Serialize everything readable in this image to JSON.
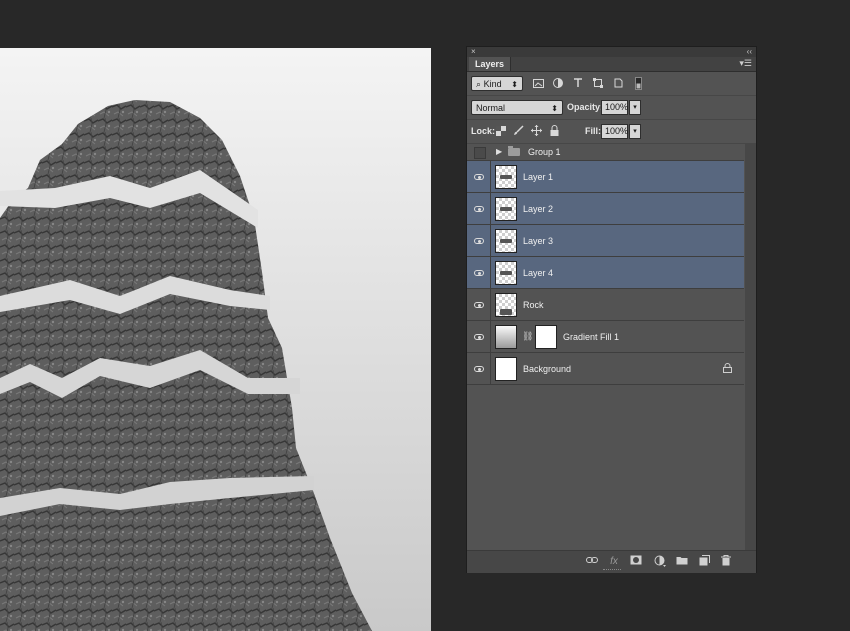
{
  "panel": {
    "close_glyph": "×",
    "collapse_glyph": "‹‹",
    "tab_label": "Layers",
    "menu_glyph": "▾☰"
  },
  "filter": {
    "kind_label": "Kind",
    "search_glyph": "⌕",
    "arrow_glyph": "⬍"
  },
  "blend": {
    "mode": "Normal",
    "arrow_glyph": "⬍",
    "opacity_label": "Opacity:",
    "opacity_value": "100%"
  },
  "lock": {
    "label": "Lock:",
    "fill_label": "Fill:",
    "fill_value": "100%"
  },
  "group": {
    "name": "Group 1",
    "expand_glyph": "▶"
  },
  "layers": [
    {
      "name": "Layer 1",
      "selected": true
    },
    {
      "name": "Layer 2",
      "selected": true
    },
    {
      "name": "Layer 3",
      "selected": true
    },
    {
      "name": "Layer 4",
      "selected": true
    },
    {
      "name": "Rock",
      "selected": false
    },
    {
      "name": "Gradient Fill 1",
      "selected": false
    },
    {
      "name": "Background",
      "selected": false
    }
  ],
  "icons": {
    "fx": "fx",
    "link": "⛓",
    "lock": "🔒"
  },
  "colors": {
    "selected_row": "#58677f",
    "panel_bg": "#535353",
    "app_bg": "#282828"
  }
}
